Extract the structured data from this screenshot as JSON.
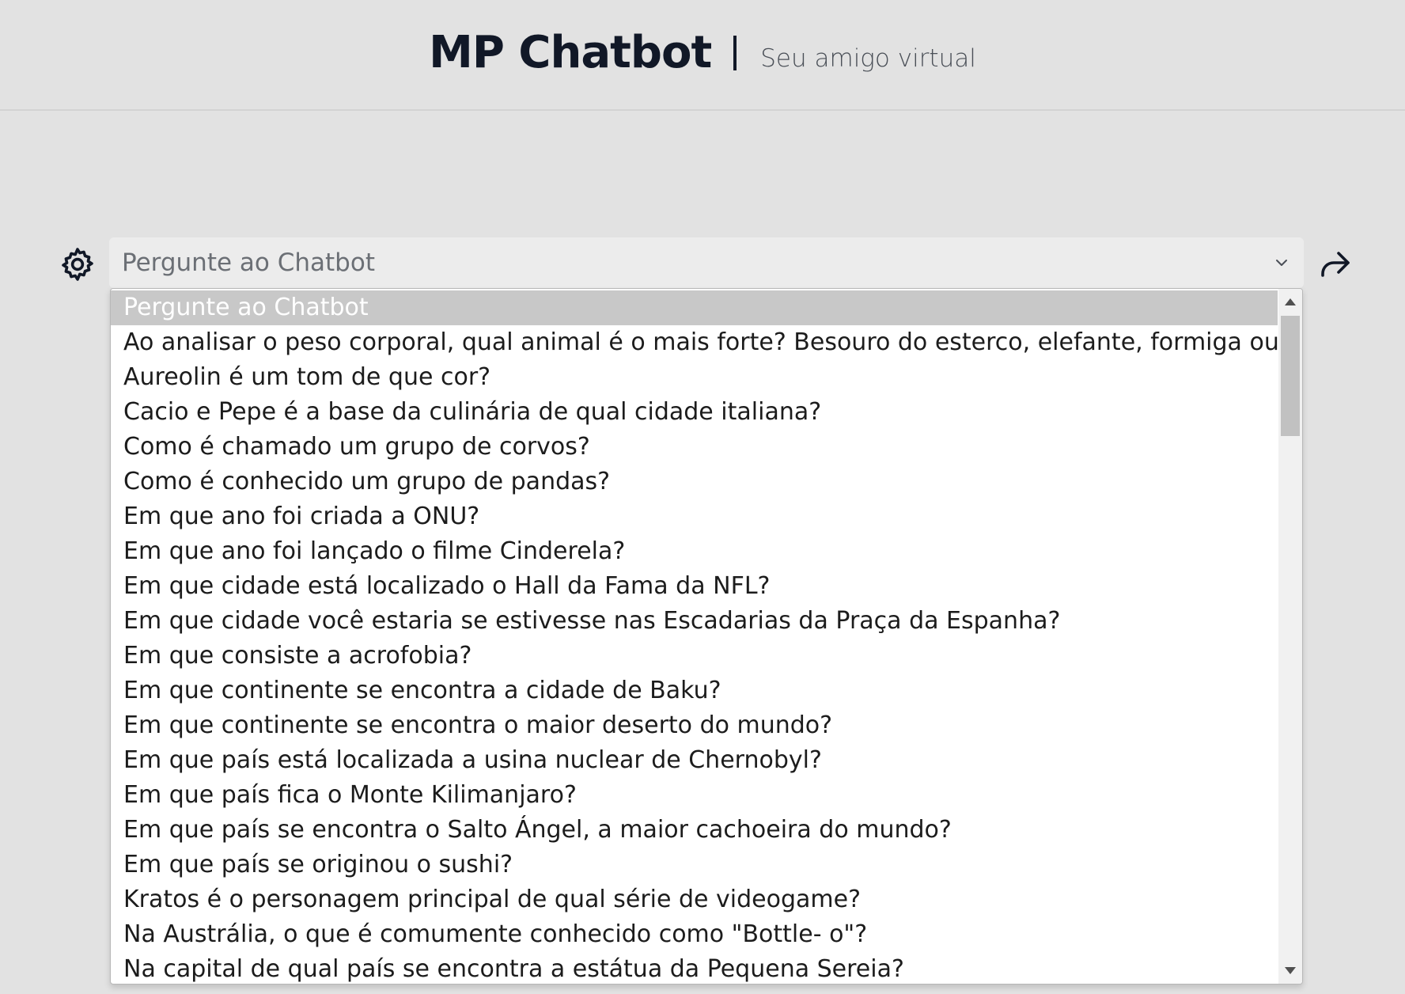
{
  "header": {
    "title": "MP Chatbot",
    "separator": "|",
    "subtitle": "Seu amigo virtual"
  },
  "icons": {
    "settings": "gear-icon",
    "share": "share-arrow-icon",
    "dropdown": "chevron-down-icon"
  },
  "question_select": {
    "placeholder": "Pergunte ao Chatbot",
    "selected_index": 0,
    "options": [
      "Pergunte ao Chatbot",
      "Ao analisar o peso corporal, qual animal é o mais forte? Besouro do esterco, elefante, formiga ou vaca?",
      "Aureolin é um tom de que cor?",
      "Cacio e Pepe é a base da culinária de qual cidade italiana?",
      "Como é chamado um grupo de corvos?",
      "Como é conhecido um grupo de pandas?",
      "Em que ano foi criada a ONU?",
      "Em que ano foi lançado o filme Cinderela?",
      "Em que cidade está localizado o Hall da Fama da NFL?",
      "Em que cidade você estaria se estivesse nas Escadarias da Praça da Espanha?",
      "Em que consiste a acrofobia?",
      "Em que continente se encontra a cidade de Baku?",
      "Em que continente se encontra o maior deserto do mundo?",
      "Em que país está localizada a usina nuclear de Chernobyl?",
      "Em que país fica o Monte Kilimanjaro?",
      "Em que país se encontra o Salto Ángel, a maior cachoeira do mundo?",
      "Em que país se originou o sushi?",
      "Kratos é o personagem principal de qual série de videogame?",
      "Na Austrália, o que é comumente conhecido como \"Bottle- o\"?",
      "Na capital de qual país se encontra a estátua da Pequena Sereia?"
    ]
  }
}
